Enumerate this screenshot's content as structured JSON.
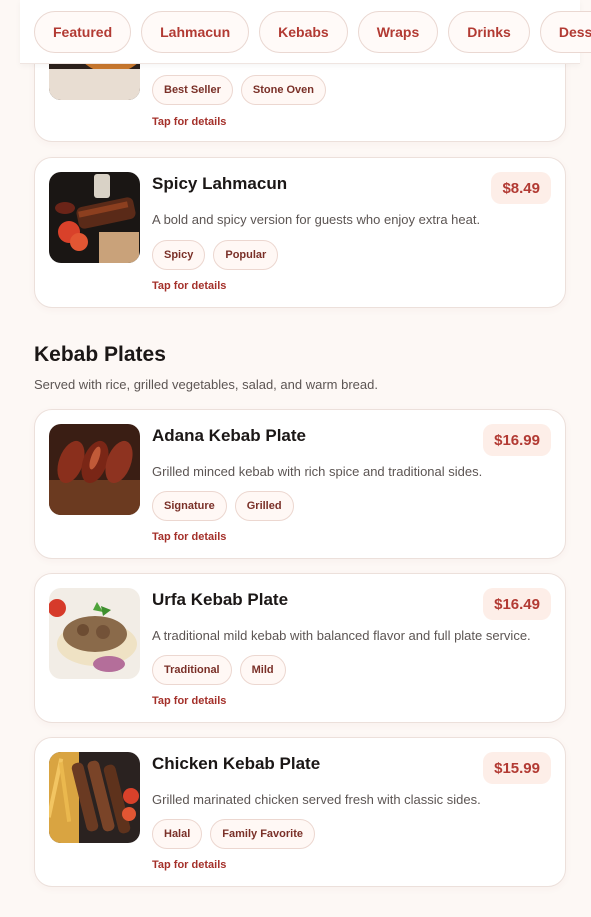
{
  "categories": [
    "Featured",
    "Lahmacun",
    "Kebabs",
    "Wraps",
    "Drinks",
    "Desserts"
  ],
  "partial_item": {
    "tags": [
      "Best Seller",
      "Stone Oven"
    ],
    "details_label": "Tap for details"
  },
  "spicy": {
    "title": "Spicy Lahmacun",
    "price": "$8.49",
    "description": "A bold and spicy version for guests who enjoy extra heat.",
    "tags": [
      "Spicy",
      "Popular"
    ],
    "details_label": "Tap for details"
  },
  "kebab_section": {
    "title": "Kebab Plates",
    "subtitle": "Served with rice, grilled vegetables, salad, and warm bread.",
    "items": [
      {
        "title": "Adana Kebab Plate",
        "price": "$16.99",
        "description": "Grilled minced kebab with rich spice and traditional sides.",
        "tags": [
          "Signature",
          "Grilled"
        ],
        "details_label": "Tap for details"
      },
      {
        "title": "Urfa Kebab Plate",
        "price": "$16.49",
        "description": "A traditional mild kebab with balanced flavor and full plate service.",
        "tags": [
          "Traditional",
          "Mild"
        ],
        "details_label": "Tap for details"
      },
      {
        "title": "Chicken Kebab Plate",
        "price": "$15.99",
        "description": "Grilled marinated chicken served fresh with classic sides.",
        "tags": [
          "Halal",
          "Family Favorite"
        ],
        "details_label": "Tap for details"
      }
    ]
  },
  "colors": {
    "accent": "#b23a33",
    "price_bg": "#fdeee8",
    "page_bg": "#fdf8f5"
  }
}
